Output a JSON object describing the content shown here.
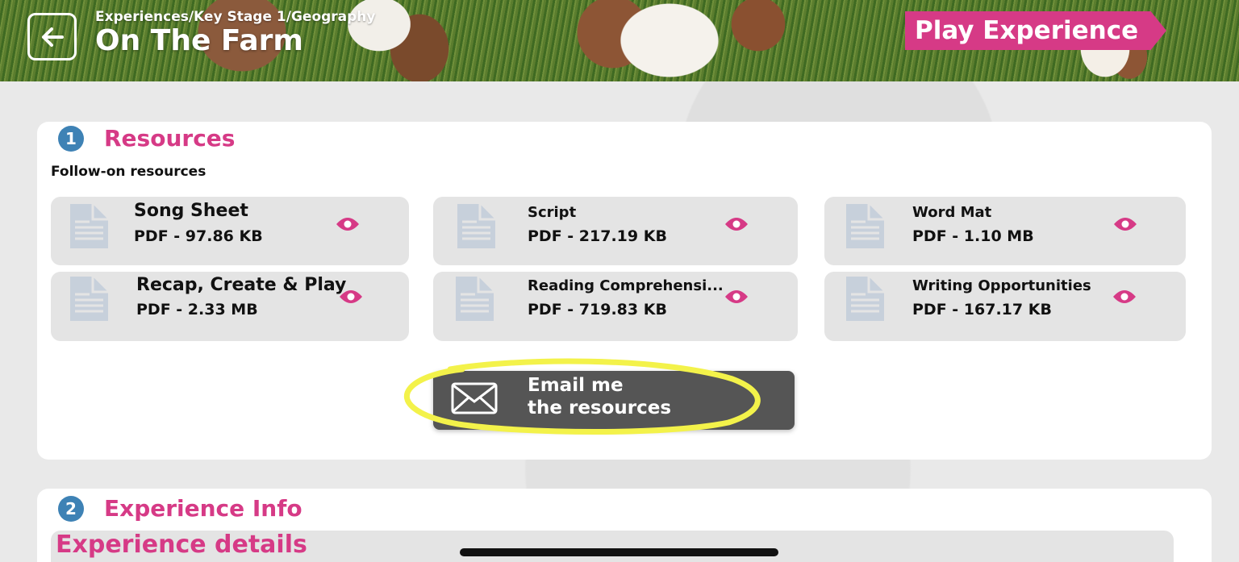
{
  "header": {
    "breadcrumb": "Experiences/Key Stage 1/Geography",
    "title": "On The Farm",
    "play_label": "Play Experience"
  },
  "resources": {
    "number": "1",
    "title": "Resources",
    "subheading": "Follow-on resources",
    "items": [
      {
        "name": "Song Sheet",
        "meta": "PDF - 97.86 KB"
      },
      {
        "name": "Script",
        "meta": "PDF - 217.19 KB"
      },
      {
        "name": "Word Mat",
        "meta": "PDF - 1.10 MB"
      },
      {
        "name": "Recap, Create & Play",
        "meta": "PDF - 2.33 MB"
      },
      {
        "name": "Reading Comprehensi...",
        "meta": "PDF - 719.83 KB"
      },
      {
        "name": "Writing Opportunities",
        "meta": "PDF - 167.17 KB"
      }
    ],
    "email_label": "Email me\nthe resources"
  },
  "info": {
    "number": "2",
    "title": "Experience Info",
    "details_title": "Experience details"
  },
  "colors": {
    "accent": "#d63a86",
    "number_badge": "#3e82b5",
    "highlight": "#f3f24a"
  }
}
